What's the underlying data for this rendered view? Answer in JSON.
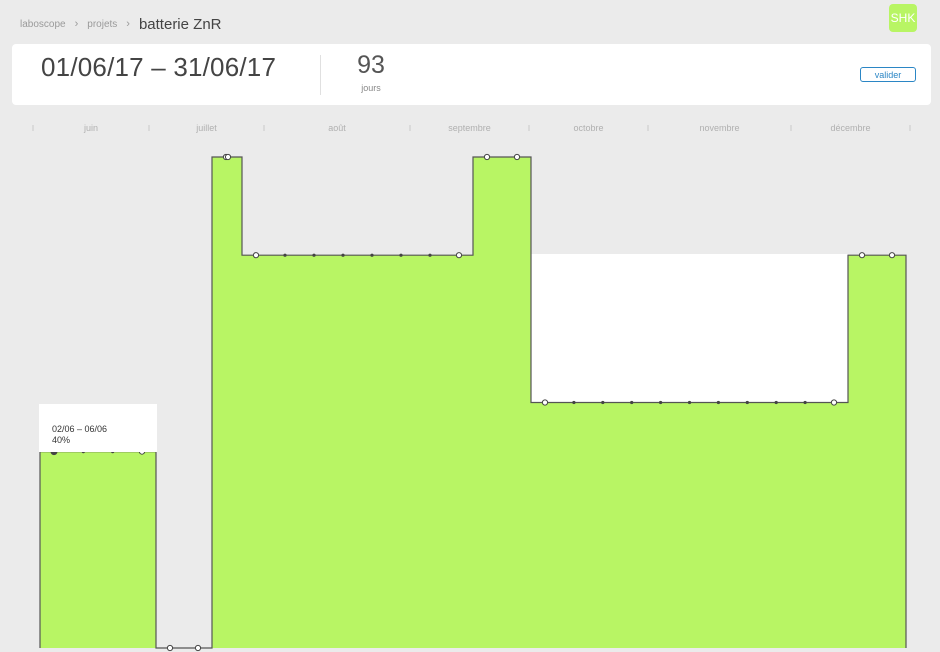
{
  "breadcrumb": {
    "root": "laboscope",
    "section": "projets",
    "current": "batterie ZnR"
  },
  "user": {
    "initials": "SHK"
  },
  "period": {
    "range": "01/06/17 – 31/06/17",
    "days_value": "93",
    "days_label": "jours",
    "validate_label": "valider"
  },
  "timeline": {
    "months": [
      "juin",
      "juillet",
      "août",
      "septembre",
      "octobre",
      "novembre",
      "décembre"
    ]
  },
  "tooltip": {
    "dates": "02/06 – 06/06",
    "value": "40%"
  },
  "chart_data": {
    "type": "area",
    "step": true,
    "fill_color": "#b8f564",
    "y_unit": "%",
    "ylim": [
      0,
      100
    ],
    "categories": [
      "juin",
      "juillet",
      "août",
      "septembre",
      "octobre",
      "novembre",
      "décembre"
    ],
    "segments": [
      {
        "value": 40,
        "points": 4
      },
      {
        "value": 0,
        "points": 2
      },
      {
        "value": 100,
        "points": 2
      },
      {
        "value": 80,
        "points": 8
      },
      {
        "value": 100,
        "points": 2
      },
      {
        "value": 50,
        "points": 11
      },
      {
        "value": 80,
        "points": 2
      }
    ]
  }
}
